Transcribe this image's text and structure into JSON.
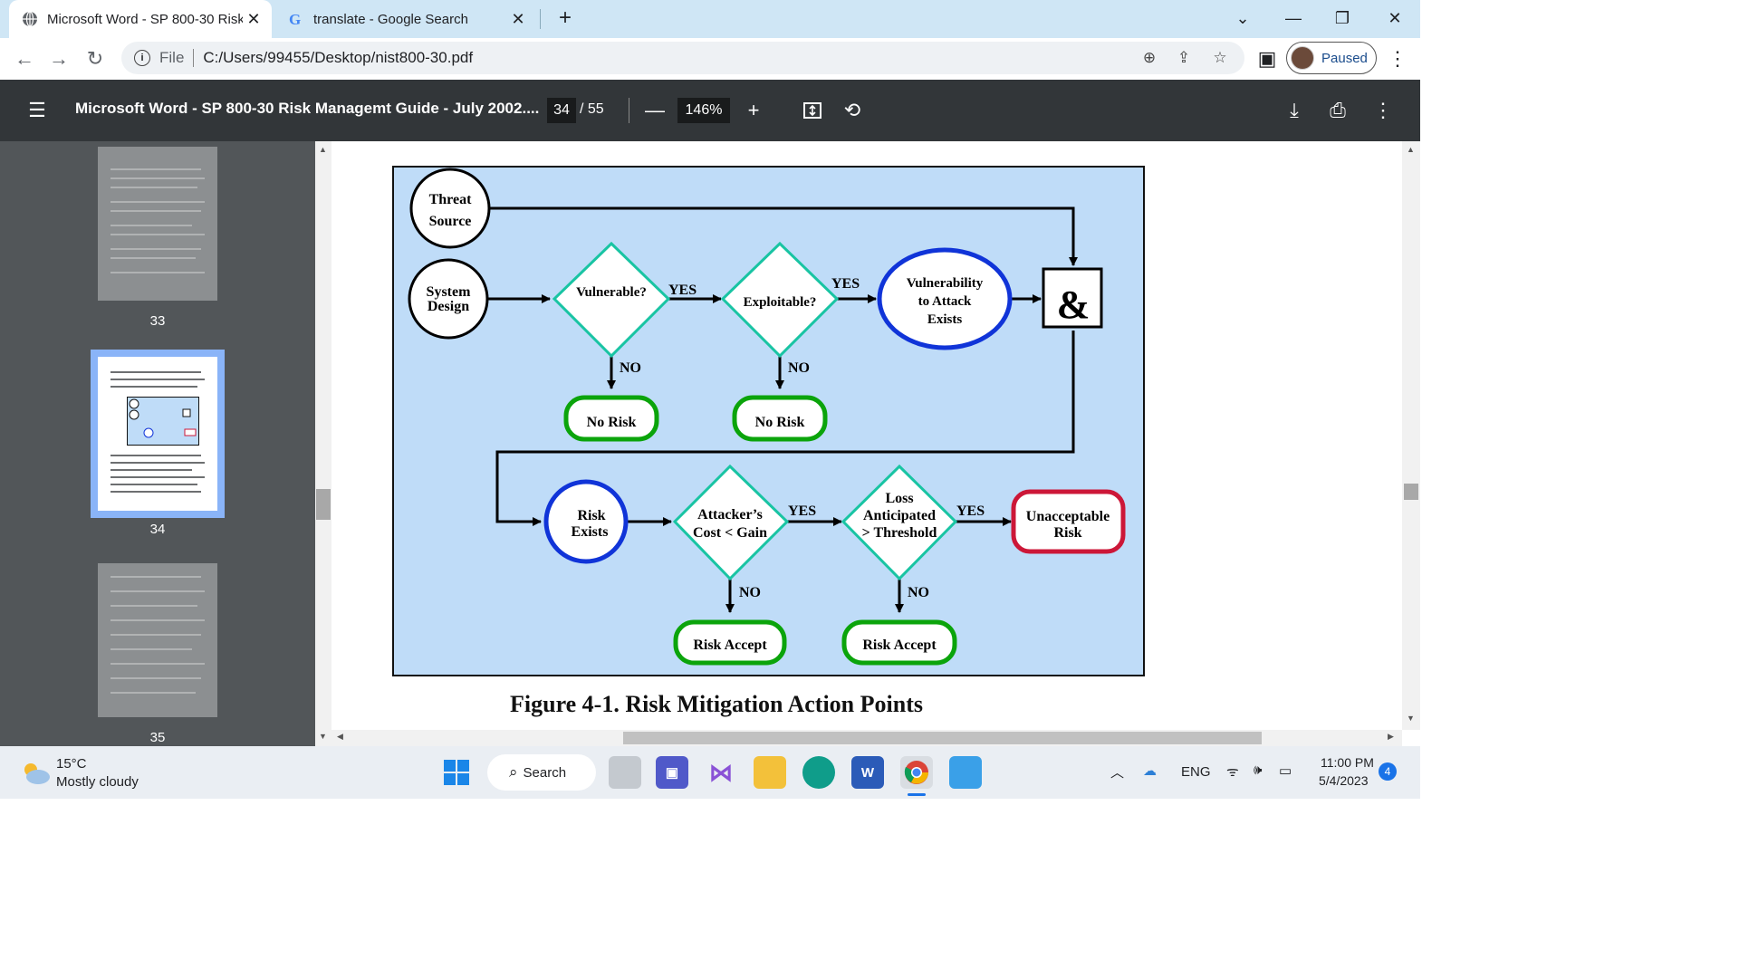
{
  "browser": {
    "tabs": [
      {
        "title": "Microsoft Word - SP 800-30 Risk",
        "icon": "globe-icon",
        "active": true
      },
      {
        "title": "translate - Google Search",
        "icon": "google-icon",
        "active": false
      }
    ],
    "address": {
      "scheme": "File",
      "url": "C:/Users/99455/Desktop/nist800-30.pdf"
    },
    "profile_status": "Paused"
  },
  "pdf_toolbar": {
    "title": "Microsoft Word - SP 800-30 Risk Managemt Guide - July 2002....",
    "current_page": "34",
    "total_pages": "/ 55",
    "zoom": "146%"
  },
  "thumbnails": [
    {
      "page": "33",
      "selected": false
    },
    {
      "page": "34",
      "selected": true
    },
    {
      "page": "35",
      "selected": false
    }
  ],
  "figure": {
    "nodes": {
      "threat_l1": "Threat",
      "threat_l2": "Source",
      "system_l1": "System",
      "system_l2": "Design",
      "vulnerable": "Vulnerable?",
      "exploitable": "Exploitable?",
      "vuln_l1": "Vulnerability",
      "vuln_l2": "to Attack",
      "vuln_l3": "Exists",
      "and": "&",
      "no_risk_1": "No Risk",
      "no_risk_2": "No Risk",
      "risk_l1": "Risk",
      "risk_l2": "Exists",
      "cost_l1": "Attacker’s",
      "cost_l2": "Cost < Gain",
      "loss_l1": "Loss",
      "loss_l2": "Anticipated",
      "loss_l3": "> Threshold",
      "unacc_l1": "Unacceptable",
      "unacc_l2": "Risk",
      "accept_1": "Risk Accept",
      "accept_2": "Risk Accept"
    },
    "yes": "YES",
    "no": "NO",
    "caption": "Figure 4-1.  Risk Mitigation Action Points"
  },
  "taskbar": {
    "weather_temp": "15°C",
    "weather_desc": "Mostly cloudy",
    "search": "Search",
    "lang": "ENG",
    "time": "11:00 PM",
    "date": "5/4/2023",
    "notifications": "4"
  },
  "colors": {
    "figure_bg": "#bfdcf8",
    "diamond": "#19c4a3",
    "blue_oval": "#1034d8",
    "green_box": "#0ba40b",
    "red_box": "#cc1738"
  }
}
